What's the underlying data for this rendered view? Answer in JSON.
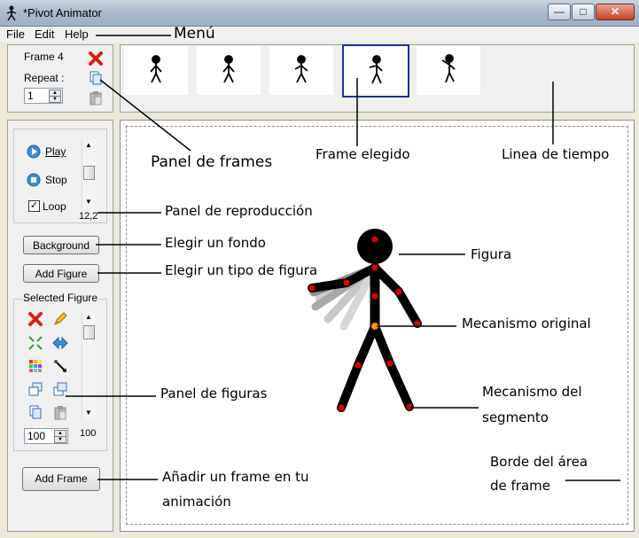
{
  "window": {
    "title": "*Pivot Animator",
    "min": "—",
    "max": "□",
    "close": "✕"
  },
  "menu": {
    "items": [
      "File",
      "Edit",
      "Help"
    ]
  },
  "frame_panel": {
    "frame_label": "Frame 4",
    "repeat_label": "Repeat :",
    "repeat_value": "1"
  },
  "timeline": {
    "frame_count": 5,
    "selected_index": 3
  },
  "playback": {
    "play_label": "Play",
    "stop_label": "Stop",
    "loop_label": "Loop",
    "loop_checked": true,
    "speed_value": "12,2"
  },
  "buttons": {
    "background": "Background",
    "add_figure": "Add Figure",
    "add_frame": "Add Frame"
  },
  "figure_panel": {
    "title": "Selected Figure",
    "size_value": "100",
    "scroll_value": "100"
  },
  "annotations": {
    "menu": "Menú",
    "panel_frames": "Panel de frames",
    "frame_elegido": "Frame elegido",
    "linea_tiempo": "Linea de tiempo",
    "panel_reproduccion": "Panel de reproducción",
    "elegir_fondo": "Elegir un fondo",
    "elegir_figura": "Elegir un tipo de figura",
    "figura": "Figura",
    "mecanismo_original": "Mecanismo original",
    "panel_figuras": "Panel de figuras",
    "mecanismo_segmento_1": "Mecanismo del",
    "mecanismo_segmento_2": "segmento",
    "anadir_frame_1": "Añadir un frame en tu",
    "anadir_frame_2": "animación",
    "borde_1": "Borde del área",
    "borde_2": "de frame"
  },
  "colors": {
    "accent": "#1a2fa0",
    "joint_red": "#e00000",
    "joint_orange": "#ff9900"
  }
}
